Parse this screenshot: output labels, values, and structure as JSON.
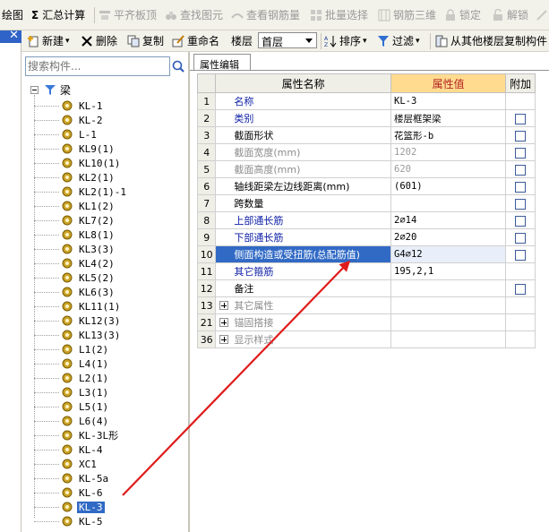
{
  "toolbar1": {
    "draw": "绘图",
    "sum_symbol": "Σ",
    "sum_calc": "汇总计算",
    "align_top": "平齐板顶",
    "find_element": "查找图元",
    "view_rebar": "查看钢筋量",
    "batch_select": "批量选择",
    "rebar_3d": "钢筋三维",
    "lock": "锁定",
    "unlock": "解锁"
  },
  "toolbar2": {
    "new": "新建",
    "delete": "删除",
    "copy": "复制",
    "rename": "重命名",
    "floor_label": "楼层",
    "floor_value": "首层",
    "sort": "排序",
    "filter": "过滤",
    "copy_from_other_floor": "从其他楼层复制构件"
  },
  "left_panel": {
    "close_symbol": "✕",
    "search_placeholder": "搜索构件...",
    "tree_root": "梁",
    "items": [
      "KL-1",
      "KL-2",
      "L-1",
      "KL9(1)",
      "KL10(1)",
      "KL2(1)",
      "KL2(1)-1",
      "KL1(2)",
      "KL7(2)",
      "KL8(1)",
      "KL3(3)",
      "KL4(2)",
      "KL5(2)",
      "KL6(3)",
      "KL11(1)",
      "KL12(3)",
      "KL13(3)",
      "L1(2)",
      "L4(1)",
      "L2(1)",
      "L3(1)",
      "L5(1)",
      "L6(4)",
      "KL-3L形",
      "KL-4",
      "XC1",
      "KL-5a",
      "KL-6",
      "KL-3",
      "KL-5"
    ],
    "selected_item": "KL-3"
  },
  "right_panel": {
    "tab": "属性编辑",
    "headers": {
      "name": "属性名称",
      "value": "属性值",
      "extra": "附加"
    },
    "rows": [
      {
        "idx": "1",
        "name": "名称",
        "value": "KL-3",
        "style": "blue",
        "checkbox": false
      },
      {
        "idx": "2",
        "name": "类别",
        "value": "楼层框架梁",
        "style": "blue",
        "checkbox": true
      },
      {
        "idx": "3",
        "name": "截面形状",
        "value": "花篮形-b",
        "style": "blk",
        "checkbox": true
      },
      {
        "idx": "4",
        "name": "截面宽度(mm)",
        "value": "1202",
        "style": "gray",
        "checkbox": true
      },
      {
        "idx": "5",
        "name": "截面高度(mm)",
        "value": "620",
        "style": "gray",
        "checkbox": true
      },
      {
        "idx": "6",
        "name": "轴线距梁左边线距离(mm)",
        "value": "(601)",
        "style": "blk",
        "checkbox": true
      },
      {
        "idx": "7",
        "name": "跨数量",
        "value": "",
        "style": "blk",
        "checkbox": true
      },
      {
        "idx": "8",
        "name": "上部通长筋",
        "value": "2⌀14",
        "style": "blue",
        "checkbox": true
      },
      {
        "idx": "9",
        "name": "下部通长筋",
        "value": "2⌀20",
        "style": "blue",
        "checkbox": true
      },
      {
        "idx": "10",
        "name": "侧面构造或受扭筋(总配筋值)",
        "value": "G4⌀12",
        "style": "blue",
        "checkbox": true,
        "selected": true
      },
      {
        "idx": "11",
        "name": "其它箍筋",
        "value": "195,2,1",
        "style": "blue",
        "checkbox": false
      },
      {
        "idx": "12",
        "name": "备注",
        "value": "",
        "style": "blk",
        "checkbox": true
      }
    ],
    "groups": [
      {
        "idx": "13",
        "name": "其它属性"
      },
      {
        "idx": "21",
        "name": "锚固搭接"
      },
      {
        "idx": "36",
        "name": "显示样式"
      }
    ]
  },
  "colors": {
    "annotation_arrow": "#e01b1b",
    "selection": "#316ac5",
    "header_highlight": "#ffdb8f"
  }
}
